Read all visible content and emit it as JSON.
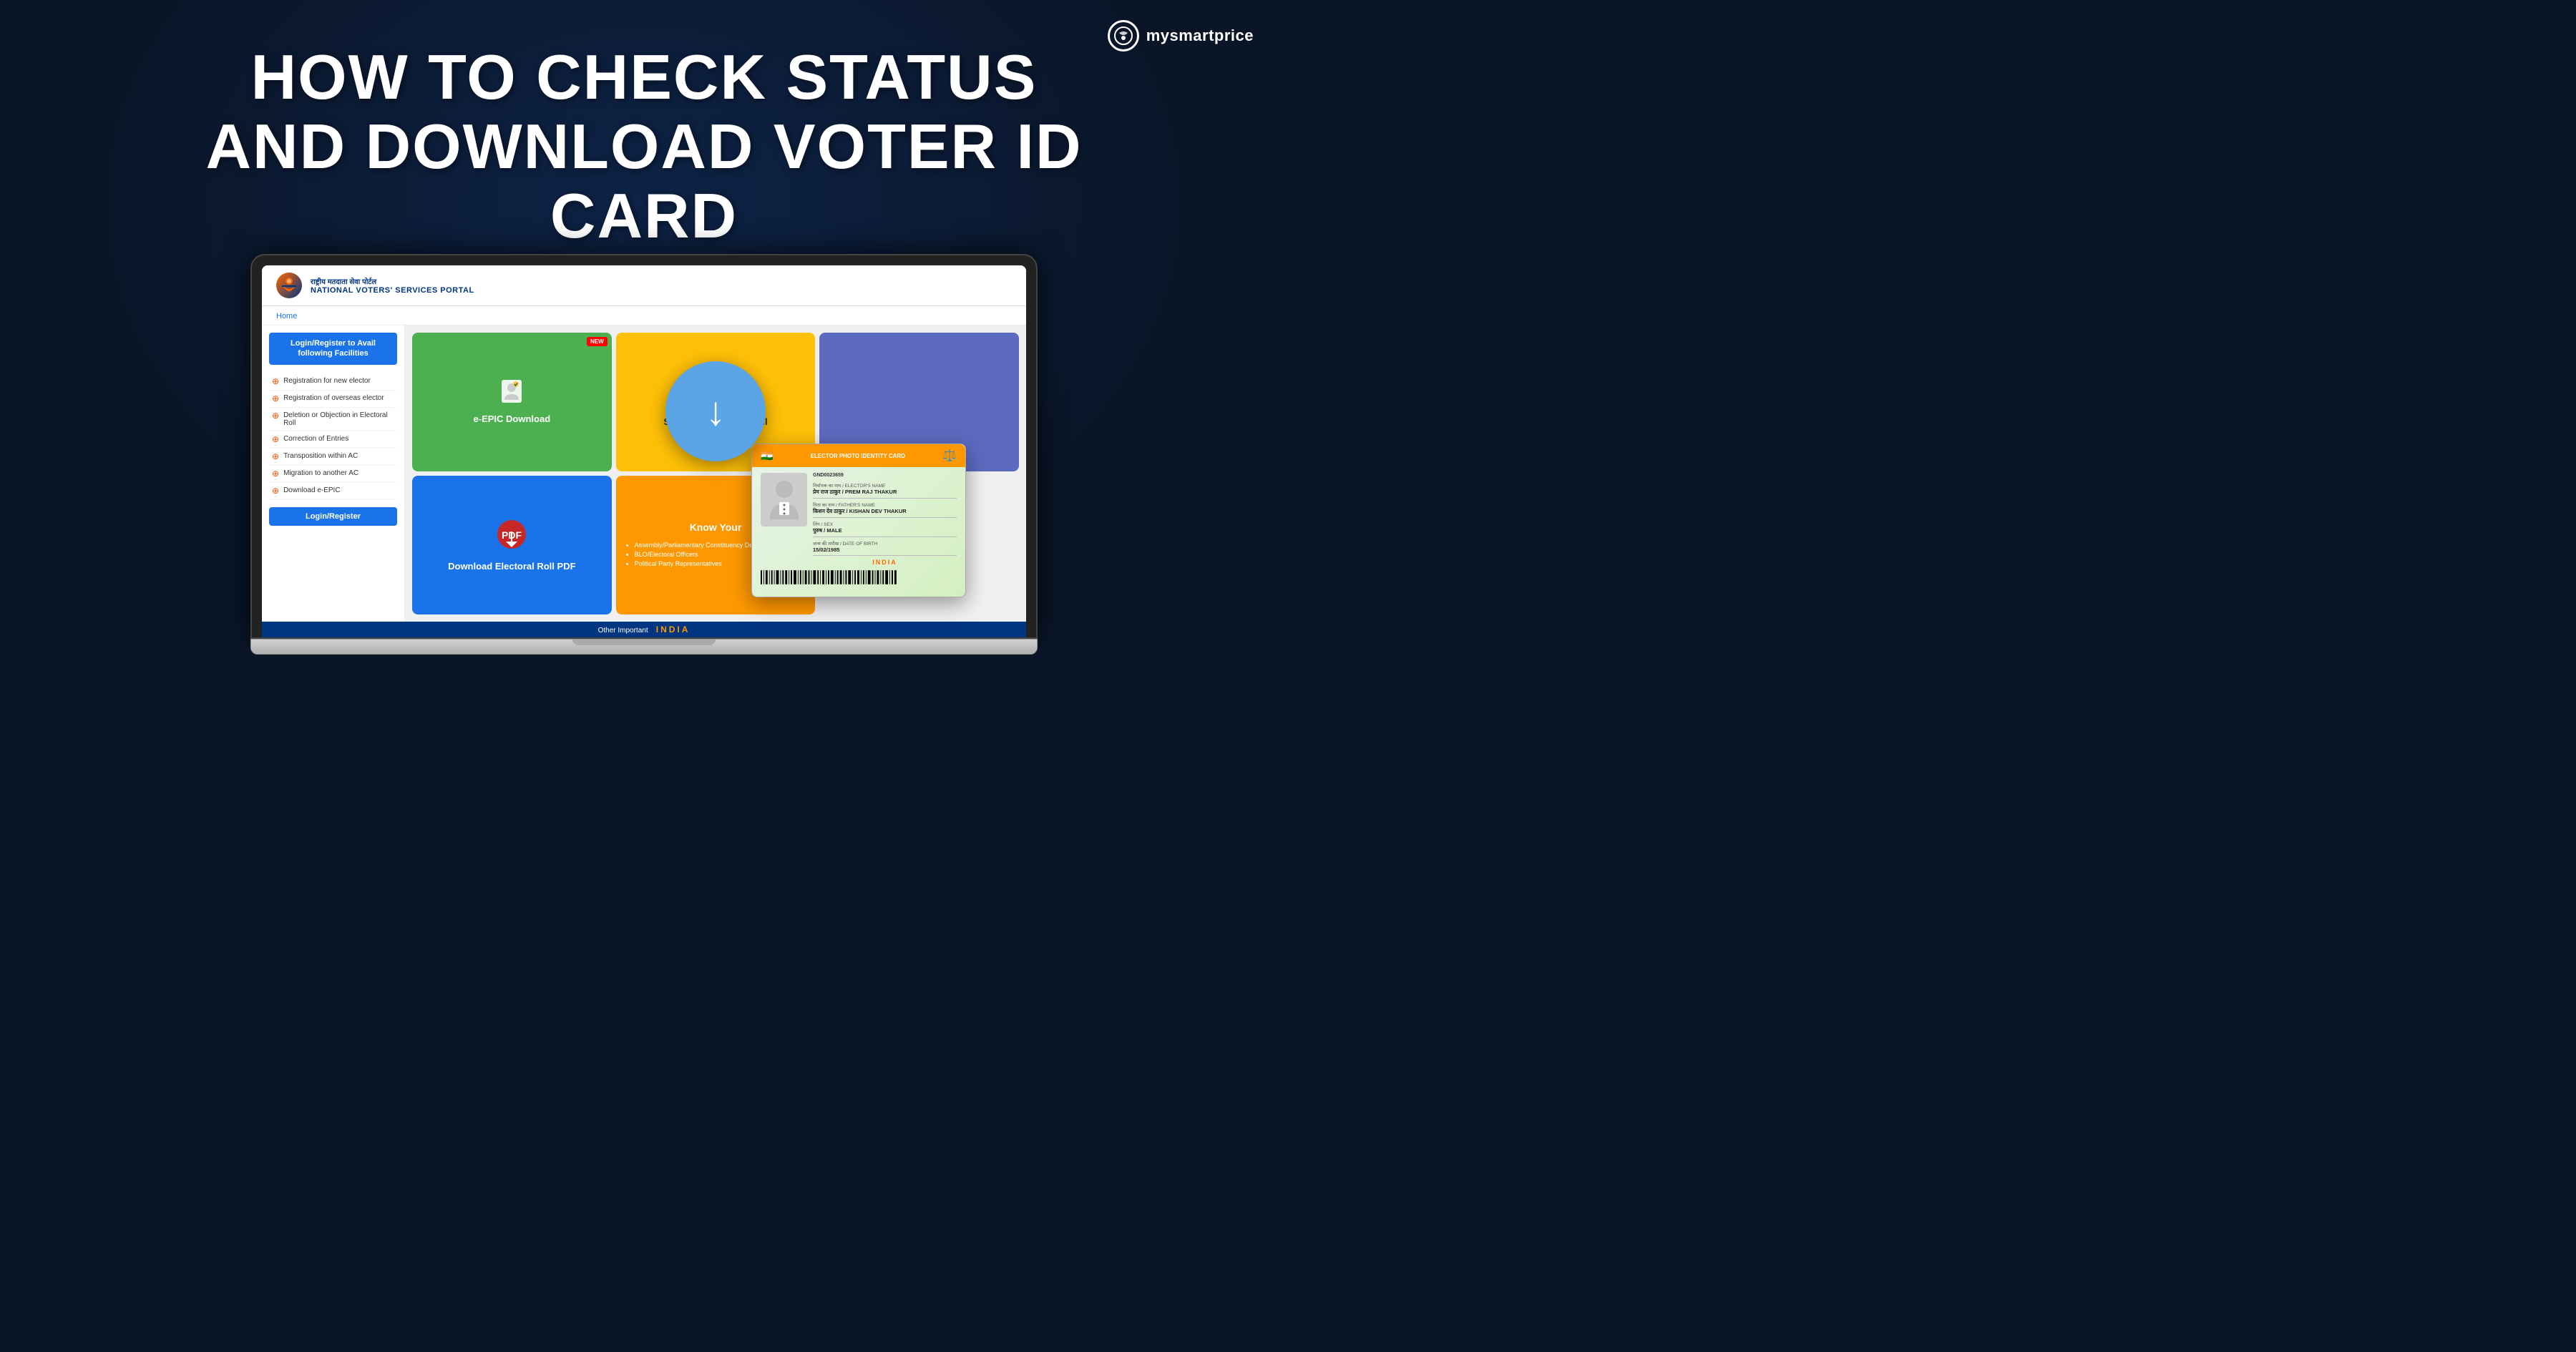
{
  "logo": {
    "icon_symbol": "⊕",
    "brand_name": "mysmartprice"
  },
  "main_title": {
    "line1": "HOW TO CHECK STATUS",
    "line2": "AND DOWNLOAD VOTER ID CARD"
  },
  "portal": {
    "hindi_title": "राष्ट्रीय मतदाता सेवा पोर्टल",
    "eng_title": "NATIONAL VOTERS' SERVICES PORTAL",
    "nav_home": "Home",
    "left_panel_heading": "Login/Register to Avail following Facilities",
    "menu_items": [
      "Registration for new elector",
      "Registration of overseas elector",
      "Deletion or Objection in Electoral Roll",
      "Correction of Entries",
      "Transposition within AC",
      "Migration to another AC",
      "Download e-EPIC"
    ],
    "login_btn": "Login/Register",
    "grid_cards": [
      {
        "id": "epic",
        "label": "e-EPIC Download",
        "bg": "#4caf50",
        "badge": "NEW",
        "icon": "👤"
      },
      {
        "id": "search",
        "label": "Search in Electoral Roll",
        "bg": "#ffc107",
        "icon": "🔍"
      },
      {
        "id": "empty",
        "label": "",
        "bg": "#5c6bc0"
      },
      {
        "id": "download",
        "label": "Download Electoral Roll PDF",
        "bg": "#1a73e8",
        "icon": "⬇"
      },
      {
        "id": "know",
        "label": "Know Your",
        "bg": "#ff9800",
        "subitems": [
          "Assembly/Parliamentary Constituency Details",
          "BLO/Electoral Officers",
          "Political Party Representatives"
        ]
      }
    ],
    "footer_text": "Other Important"
  },
  "voter_card": {
    "header_text": "ELECTOR PHOTO IDENTITY CARD",
    "id_number": "GND0023659",
    "elector_label": "निर्वाचक का नाम / ELECTOR'S NAME",
    "elector_value": "प्रेम राज ठाकुर / PREM RAJ THAKUR",
    "father_label": "पिता का नाम / FATHER'S NAME",
    "father_value": "किशन देव ठाकुर / KISHAN DEV THAKUR",
    "sex_label": "लिंग / SEX",
    "sex_value": "पुरुष / MALE",
    "dob_label": "जन्म की तारीख / DATE OF BIRTH",
    "dob_value": "15/02/1985",
    "india_text": "INDIA"
  },
  "download_overlay": {
    "symbol": "↓"
  }
}
